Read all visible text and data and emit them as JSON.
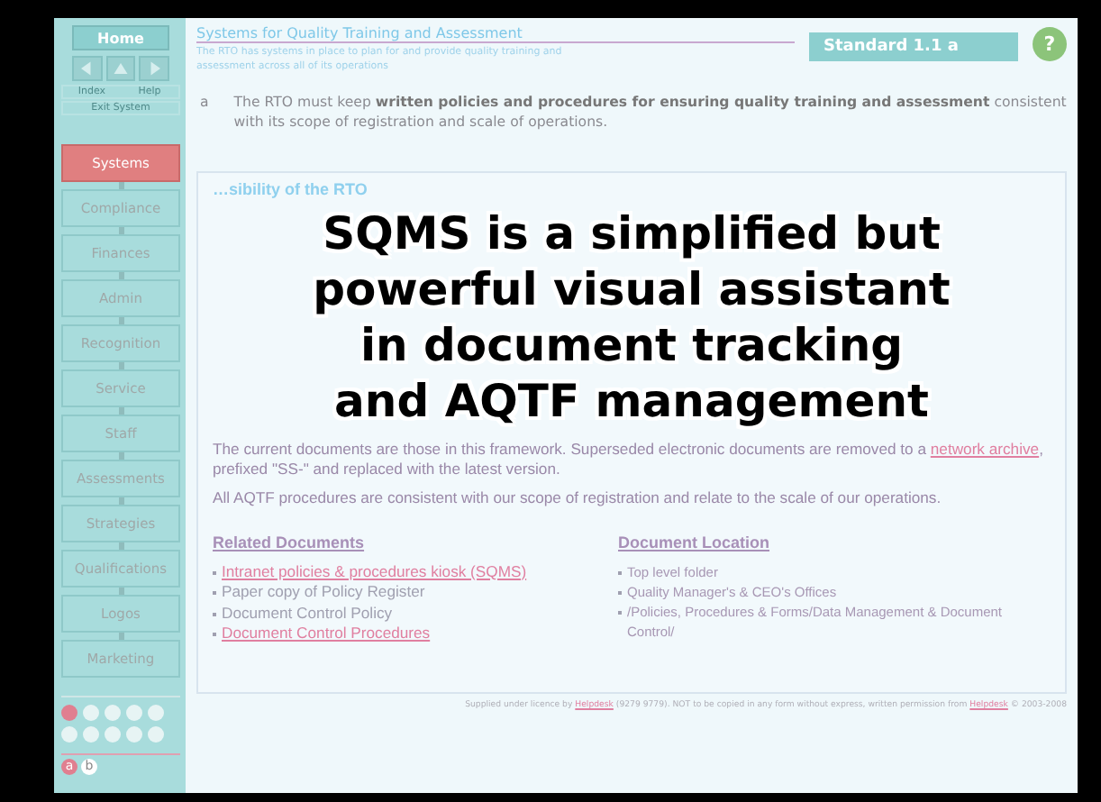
{
  "sidebar": {
    "home": "Home",
    "nav_buttons": [
      {
        "kind": "back"
      },
      {
        "kind": "up"
      },
      {
        "kind": "forward"
      }
    ],
    "links": [
      "Index",
      "Help"
    ],
    "exit": "Exit System",
    "items": [
      {
        "label": "Systems",
        "selected": true
      },
      {
        "label": "Compliance",
        "selected": false
      },
      {
        "label": "Finances",
        "selected": false
      },
      {
        "label": "Admin",
        "selected": false
      },
      {
        "label": "Recognition",
        "selected": false
      },
      {
        "label": "Service",
        "selected": false
      },
      {
        "label": "Staff",
        "selected": false
      },
      {
        "label": "Assessments",
        "selected": false
      },
      {
        "label": "Strategies",
        "selected": false
      },
      {
        "label": "Qualifications",
        "selected": false
      },
      {
        "label": "Logos",
        "selected": false
      },
      {
        "label": "Marketing",
        "selected": false
      }
    ],
    "page_dots": [
      {
        "selected": true
      },
      {
        "selected": false
      },
      {
        "selected": false
      },
      {
        "selected": false
      },
      {
        "selected": false
      },
      {
        "selected": false
      },
      {
        "selected": false
      },
      {
        "selected": false
      },
      {
        "selected": false
      },
      {
        "selected": false
      }
    ],
    "sub_pages": [
      {
        "label": "a",
        "selected": true
      },
      {
        "label": "b",
        "selected": false
      }
    ]
  },
  "header": {
    "title": "Systems for Quality Training and Assessment",
    "subtitle": "The RTO has systems in place to plan for and provide quality training and assessment across all of its operations",
    "standard": "Standard 1.1 a",
    "help": "?"
  },
  "criterion": {
    "letter": "a",
    "text": "The RTO must keep **written policies and procedures for ensuring quality training and assessment** consistent with its scope of registration and scale of operations."
  },
  "body": {
    "heading": "…sibility of the RTO",
    "paragraphs": [
      [
        {
          "text": "The current documents are those in this framework. Superseded electronic documents are removed to a ",
          "link": false
        },
        {
          "text": "network archive",
          "link": true
        },
        {
          "text": ", prefixed \"SS-\" and replaced with the latest version.",
          "link": false
        }
      ],
      [
        {
          "text": "All AQTF procedures are consistent with our scope of registration and relate to the scale of our operations.",
          "link": false
        }
      ]
    ],
    "related": {
      "heading": "Related Documents",
      "items": [
        {
          "text": "Intranet policies & procedures kiosk (SQMS)",
          "link": true
        },
        {
          "text": "Paper copy of Policy Register",
          "link": false
        },
        {
          "text": "Document Control Policy",
          "link": false
        },
        {
          "text": "Document Control Procedures",
          "link": true
        }
      ]
    },
    "location": {
      "heading": "Document Location",
      "items": [
        "Top level folder",
        "Quality Manager's & CEO's Offices",
        "/Policies, Procedures & Forms/Data Management & Document Control/"
      ]
    }
  },
  "footer": [
    {
      "text": "Supplied under licence by ",
      "link": false
    },
    {
      "text": "Helpdesk",
      "link": true
    },
    {
      "text": " (9279 9779). NOT to be copied in any form without express, written permission from ",
      "link": false
    },
    {
      "text": "Helpdesk",
      "link": true
    },
    {
      "text": " © 2003-2008",
      "link": false
    }
  ],
  "overlay_caption": [
    "SQMS is a simplified but",
    "powerful visual assistant",
    "in document tracking",
    "and AQTF management"
  ]
}
